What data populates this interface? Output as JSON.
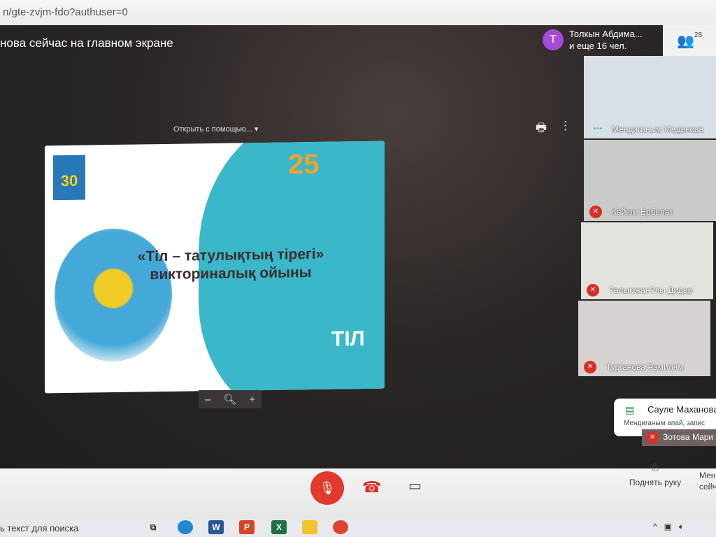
{
  "browser": {
    "url_fragment": "n/gte-zvjm-fdo?authuser=0"
  },
  "meeting": {
    "presenting_label": "нова сейчас на главном экране",
    "user_avatar_letter": "Т",
    "user_line1": "Толкын Абдима...",
    "user_line2": "и еще 16 чел.",
    "participants_count": "28",
    "viewer_open_with": "Открыть с помощью...",
    "zoom_minus": "–",
    "zoom_plus": "+"
  },
  "slide": {
    "badge_30": "30",
    "badge_25": "25",
    "title_line1": "«Тіл – татулықтың тірегі»",
    "title_line2": "викториналық  ойыны",
    "til_logo": "ТІЛ"
  },
  "tiles": [
    {
      "name": "Мендиганым Маданова",
      "muted": false,
      "color": "#d9dfe6"
    },
    {
      "name": "Кайюм Ерболат",
      "muted": true,
      "color": "#c9cbc8"
    },
    {
      "name": "?алымжан?лы Дидар",
      "muted": true,
      "color": "#e4e2dc"
    },
    {
      "name": "Турганова Рамилям",
      "muted": true,
      "color": "#d6d2d1"
    }
  ],
  "chat_popup": {
    "sender": "Сауле Маханова",
    "message": "Мендиганым апай, запис"
  },
  "partial_tile": {
    "name": "Зотова Мари"
  },
  "controls": {
    "raise_hand": "Поднять руку",
    "more_line1": "Мен",
    "more_line2": "сейч"
  },
  "taskbar": {
    "search_placeholder": "ь текст для поиска"
  }
}
